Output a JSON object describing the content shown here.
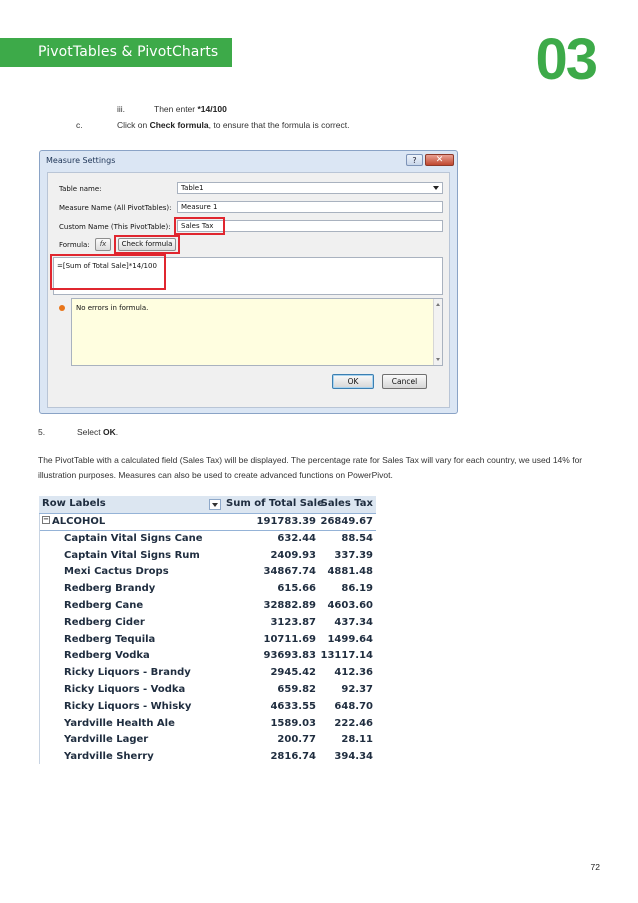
{
  "header": {
    "section_title": "PivotTables & PivotCharts",
    "chapter_number": "03"
  },
  "steps": {
    "step_iii": {
      "marker": "iii.",
      "text": "Then enter ",
      "bold": "*14/100"
    },
    "step_c": {
      "marker": "c.",
      "text_before": "Click on ",
      "bold": "Check formula",
      "text_after": ", to ensure that the formula is correct."
    },
    "step_5": {
      "marker": "5.",
      "text_before": "Select ",
      "bold": "OK",
      "text_after": "."
    },
    "paragraph": "The PivotTable with a calculated field (Sales Tax) will be displayed. The percentage rate for Sales Tax will vary for each country, we used 14% for illustration purposes. Measures can also be used to create advanced functions on PowerPivot."
  },
  "dialog": {
    "title": "Measure Settings",
    "help_label": "?",
    "close_label": "✕",
    "table_name_label": "Table name:",
    "table_name_value": "Table1",
    "measure_name_label": "Measure Name (All PivotTables):",
    "measure_name_value": "Measure 1",
    "custom_name_label": "Custom Name (This PivotTable):",
    "custom_name_value": "Sales Tax",
    "formula_label": "Formula:",
    "fx_label": "fx",
    "check_formula_label": "Check formula",
    "formula_value": "=[Sum of Total Sale]*14/100",
    "message": "No errors in formula.",
    "ok_label": "OK",
    "cancel_label": "Cancel"
  },
  "pivot": {
    "headers": [
      "Row Labels",
      "Sum of Total Sale",
      "Sales Tax"
    ],
    "group": {
      "name": "ALCOHOL",
      "total": "191783.39",
      "tax": "26849.67"
    },
    "rows": [
      {
        "name": "Captain Vital Signs Cane",
        "total": "632.44",
        "tax": "88.54"
      },
      {
        "name": "Captain Vital Signs Rum",
        "total": "2409.93",
        "tax": "337.39"
      },
      {
        "name": "Mexi Cactus Drops",
        "total": "34867.74",
        "tax": "4881.48"
      },
      {
        "name": "Redberg Brandy",
        "total": "615.66",
        "tax": "86.19"
      },
      {
        "name": "Redberg Cane",
        "total": "32882.89",
        "tax": "4603.60"
      },
      {
        "name": "Redberg Cider",
        "total": "3123.87",
        "tax": "437.34"
      },
      {
        "name": "Redberg Tequila",
        "total": "10711.69",
        "tax": "1499.64"
      },
      {
        "name": "Redberg Vodka",
        "total": "93693.83",
        "tax": "13117.14"
      },
      {
        "name": "Ricky Liquors - Brandy",
        "total": "2945.42",
        "tax": "412.36"
      },
      {
        "name": "Ricky Liquors - Vodka",
        "total": "659.82",
        "tax": "92.37"
      },
      {
        "name": "Ricky Liquors - Whisky",
        "total": "4633.55",
        "tax": "648.70"
      },
      {
        "name": "Yardville Health Ale",
        "total": "1589.03",
        "tax": "222.46"
      },
      {
        "name": "Yardville Lager",
        "total": "200.77",
        "tax": "28.11"
      },
      {
        "name": "Yardville Sherry",
        "total": "2816.74",
        "tax": "394.34"
      }
    ]
  },
  "page_number": "72",
  "colors": {
    "brand_green": "#3daa49",
    "highlight_red": "#e0262f"
  }
}
